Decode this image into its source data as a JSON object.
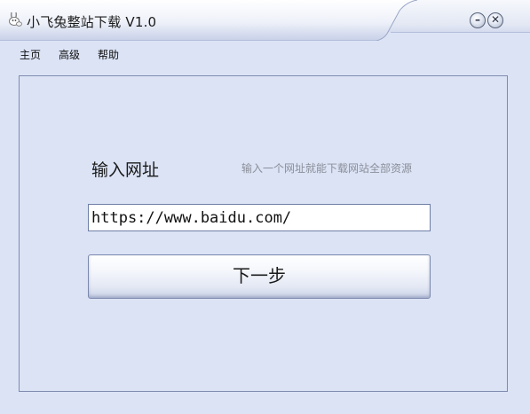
{
  "window": {
    "title": "小飞兔整站下载 V1.0",
    "minimize_glyph": "–",
    "close_glyph": "✕"
  },
  "menu": {
    "items": [
      {
        "label": "主页"
      },
      {
        "label": "高级"
      },
      {
        "label": "帮助"
      }
    ]
  },
  "form": {
    "url_label": "输入网址",
    "hint": "输入一个网址就能下载网站全部资源",
    "url_value": "https://www.baidu.com/",
    "next_button": "下一步"
  },
  "icons": {
    "app": "rabbit-icon",
    "minimize": "minimize-icon",
    "close": "close-icon"
  },
  "colors": {
    "background": "#dbe3f5",
    "titlebar_light": "#f4f6fb",
    "titlebar_accent": "#b8c3e0",
    "panel_border": "#7d8bb0",
    "hint_text": "#8c8f99"
  }
}
